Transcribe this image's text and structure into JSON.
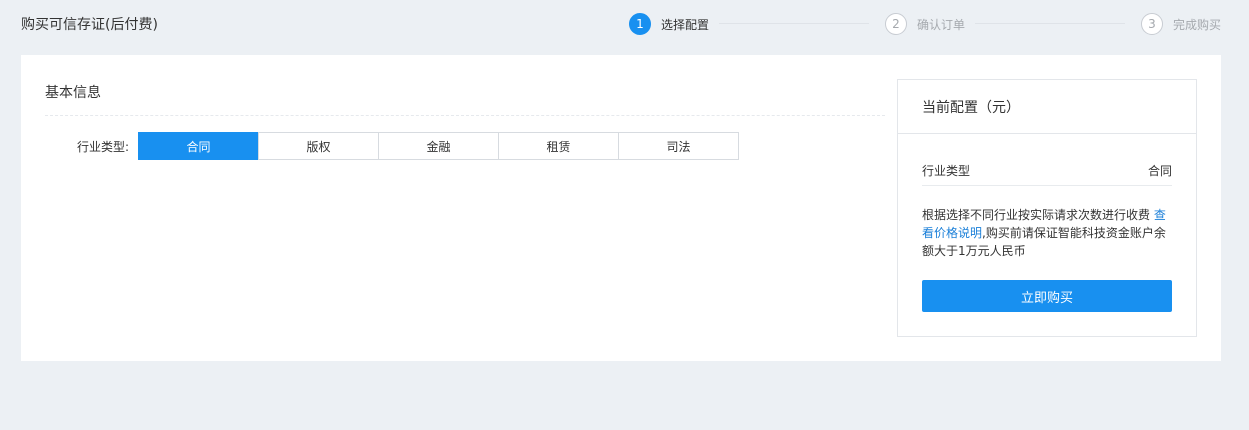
{
  "header": {
    "title": "购买可信存证(后付费)"
  },
  "steps": [
    {
      "num": "1",
      "label": "选择配置",
      "active": true
    },
    {
      "num": "2",
      "label": "确认订单",
      "active": false
    },
    {
      "num": "3",
      "label": "完成购买",
      "active": false
    }
  ],
  "basic_info": {
    "title": "基本信息",
    "industry_label": "行业类型:",
    "options": [
      "合同",
      "版权",
      "金融",
      "租赁",
      "司法"
    ],
    "selected": "合同"
  },
  "summary": {
    "title": "当前配置（元）",
    "row_label": "行业类型",
    "row_value": "合同",
    "note_before": "根据选择不同行业按实际请求次数进行收费 ",
    "note_link": "查看价格说明",
    "note_after": ",购买前请保证智能科技资金账户余额大于1万元人民币",
    "buy_label": "立即购买"
  },
  "colors": {
    "accent": "#1890f0",
    "background": "#ecf0f4",
    "link": "#1a7fd8"
  }
}
